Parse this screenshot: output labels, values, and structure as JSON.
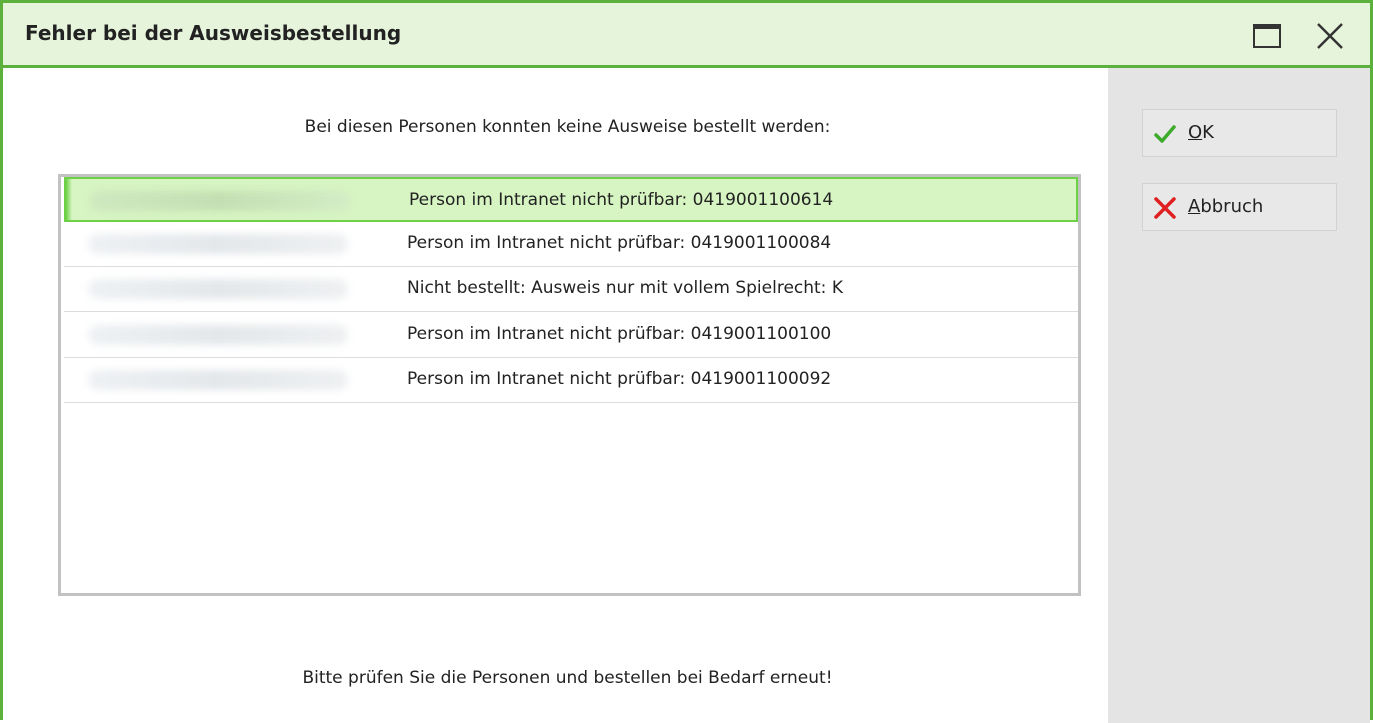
{
  "window": {
    "title": "Fehler bei der Ausweisbestellung"
  },
  "dialog": {
    "heading": "Bei diesen Personen konnten keine Ausweise bestellt werden:",
    "footer": "Bitte prüfen Sie die Personen und bestellen bei Bedarf erneut!"
  },
  "list": {
    "rows": [
      {
        "message": "Person im Intranet nicht prüfbar: 0419001100614",
        "selected": true
      },
      {
        "message": "Person im Intranet nicht prüfbar: 0419001100084",
        "selected": false
      },
      {
        "message": "Nicht bestellt: Ausweis nur mit vollem Spielrecht: K",
        "selected": false
      },
      {
        "message": "Person im Intranet nicht prüfbar: 0419001100100",
        "selected": false
      },
      {
        "message": "Person im Intranet nicht prüfbar: 0419001100092",
        "selected": false
      }
    ]
  },
  "buttons": {
    "ok": {
      "mnemonic": "O",
      "rest": "K",
      "icon": "checkmark-icon"
    },
    "cancel": {
      "mnemonic": "A",
      "rest": "bbruch",
      "icon": "x-cross-icon"
    }
  },
  "colors": {
    "accent": "#5bb13b",
    "titlebar_bg": "#e6f4dc",
    "selection_bg": "#d6f5c2",
    "selection_border": "#6ed046",
    "cancel_red": "#e02020",
    "ok_green": "#3cab2a"
  }
}
